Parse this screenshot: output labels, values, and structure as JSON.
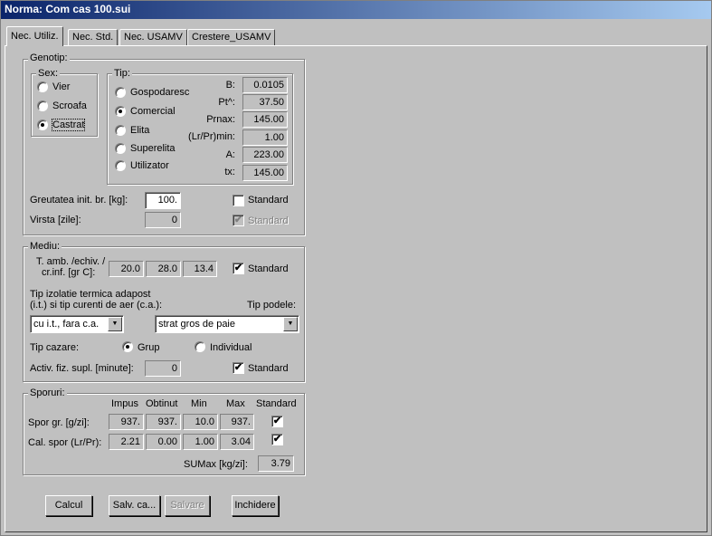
{
  "window": {
    "title": "Norma: Com cas 100.sui"
  },
  "tabs": [
    {
      "label": "Nec. Utiliz.",
      "active": true
    },
    {
      "label": "Nec. Std."
    },
    {
      "label": "Nec. USAMV"
    },
    {
      "label": "Crestere_USAMV"
    }
  ],
  "genotip": {
    "legend": "Genotip:",
    "sex": {
      "legend": "Sex:",
      "options": [
        "Vier",
        "Scroafa",
        "Castrat"
      ],
      "selected": "Castrat"
    },
    "tip": {
      "legend": "Tip:",
      "options": [
        "Gospodaresc",
        "Comercial",
        "Elita",
        "Superelita",
        "Utilizator"
      ],
      "selected": "Comercial",
      "params": [
        {
          "label": "B:",
          "value": "0.0105"
        },
        {
          "label": "Pt^:",
          "value": "37.50"
        },
        {
          "label": "Prnax:",
          "value": "145.00"
        },
        {
          "label": "(Lr/Pr)min:",
          "value": "1.00"
        },
        {
          "label": "A:",
          "value": "223.00"
        },
        {
          "label": "tx:",
          "value": "145.00"
        }
      ]
    },
    "greutatea": {
      "label": "Greutatea init. br. [kg]:",
      "value": "100.",
      "standard_label": "Standard",
      "standard_checked": false
    },
    "virsta": {
      "label": "Virsta [zile]:",
      "value": "0",
      "standard_label": "Standard",
      "standard_checked": true,
      "disabled": true
    }
  },
  "mediu": {
    "legend": "Mediu:",
    "temp_label_1": "T. amb. /echiv. /",
    "temp_label_2": "cr.inf. [gr C]:",
    "temps": [
      "20.0",
      "28.0",
      "13.4"
    ],
    "temp_standard_label": "Standard",
    "temp_standard_checked": true,
    "izolatie_label_1": "Tip izolatie termica adapost",
    "izolatie_label_2": "(i.t.) si tip curenti de aer (c.a.):",
    "izolatie_value": "cu i.t., fara c.a.",
    "podele_label": "Tip podele:",
    "podele_value": "strat gros de paie",
    "cazare": {
      "label": "Tip cazare:",
      "options": [
        "Grup",
        "Individual"
      ],
      "selected": "Grup"
    },
    "activ": {
      "label": "Activ. fiz. supl. [minute]:",
      "value": "0",
      "standard_label": "Standard",
      "standard_checked": true
    }
  },
  "sporuri": {
    "legend": "Sporuri:",
    "columns": [
      "Impus",
      "Obtinut",
      "Min",
      "Max",
      "Standard"
    ],
    "rows": [
      {
        "label": "Spor gr. [g/zi]:",
        "values": [
          "937.",
          "937.",
          "10.0",
          "937."
        ],
        "standard": true
      },
      {
        "label": "Cal. spor (Lr/Pr):",
        "values": [
          "2.21",
          "0.00",
          "1.00",
          "3.04"
        ],
        "standard": true
      }
    ],
    "sumax_label": "SUMax [kg/zi]:",
    "sumax_value": "3.79"
  },
  "buttons": {
    "calcul": "Calcul",
    "salv_ca": "Salv. ca...",
    "salvare": "Salvare",
    "inchidere": "Inchidere"
  },
  "icons": {
    "check": "✔",
    "dropdown": "▼"
  }
}
